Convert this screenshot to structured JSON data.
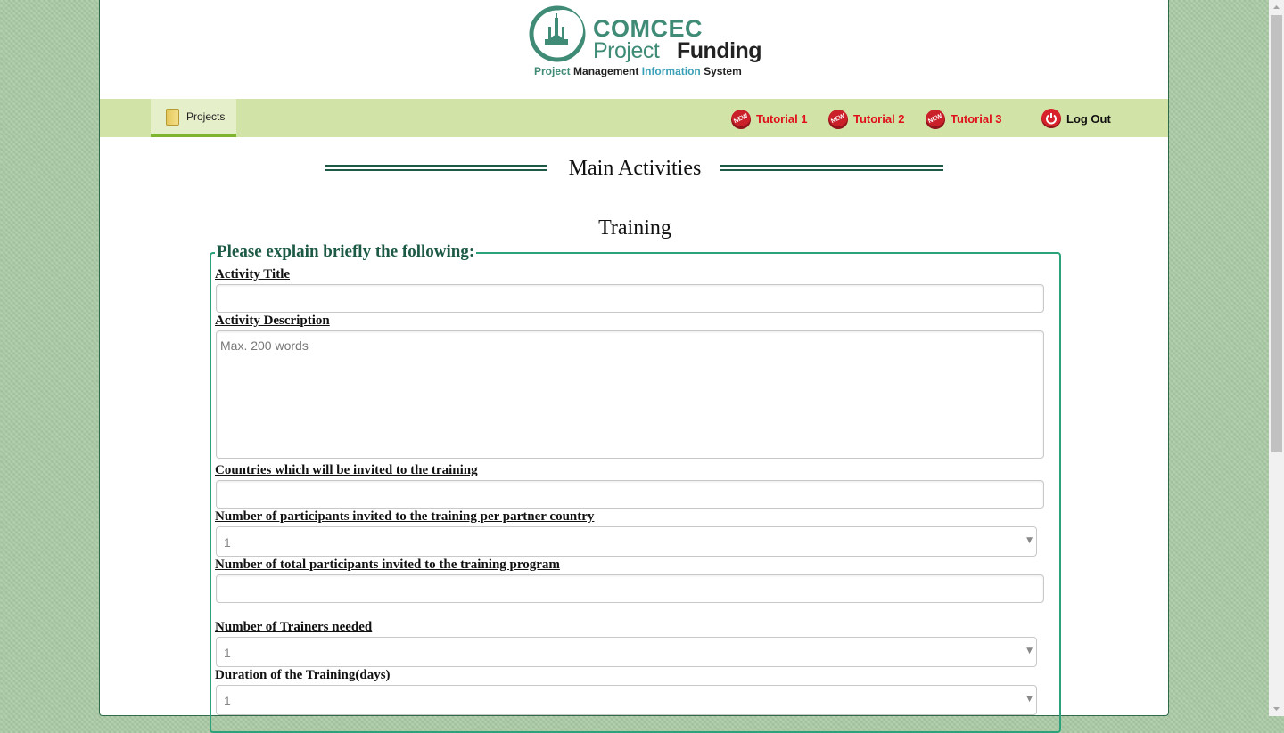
{
  "logo": {
    "line1": "COMCEC",
    "line2a": "Project",
    "line2b": "Funding",
    "sub_project": "Project",
    "sub_management": "Management",
    "sub_information": "Information",
    "sub_system": "System"
  },
  "nav": {
    "projects_label": "Projects",
    "new_badge": "NEW",
    "tutorials": [
      "Tutorial 1",
      "Tutorial 2",
      "Tutorial 3"
    ],
    "logout_label": "Log Out"
  },
  "page": {
    "section_title": "Main Activities",
    "subtitle": "Training"
  },
  "form": {
    "legend": "Please explain briefly the following:",
    "activity_title_label": "Activity Title",
    "activity_title_value": "",
    "activity_description_label": "Activity Description",
    "activity_description_placeholder": "Max. 200 words",
    "countries_label": "Countries which will be invited to the training",
    "countries_value": "",
    "participants_per_country_label": "Number of participants invited to the training per partner country",
    "participants_per_country_value": "1",
    "total_participants_label": "Number of total participants invited to the training program",
    "total_participants_value": "",
    "trainers_label": "Number of Trainers needed",
    "trainers_value": "1",
    "duration_label": "Duration of the Training(days)",
    "duration_value": "1"
  },
  "colors": {
    "brand_green": "#3f8b76",
    "nav_bg": "#d2e3a8",
    "tutorial_red": "#e0101a",
    "fieldset_border": "#2ba27a"
  }
}
